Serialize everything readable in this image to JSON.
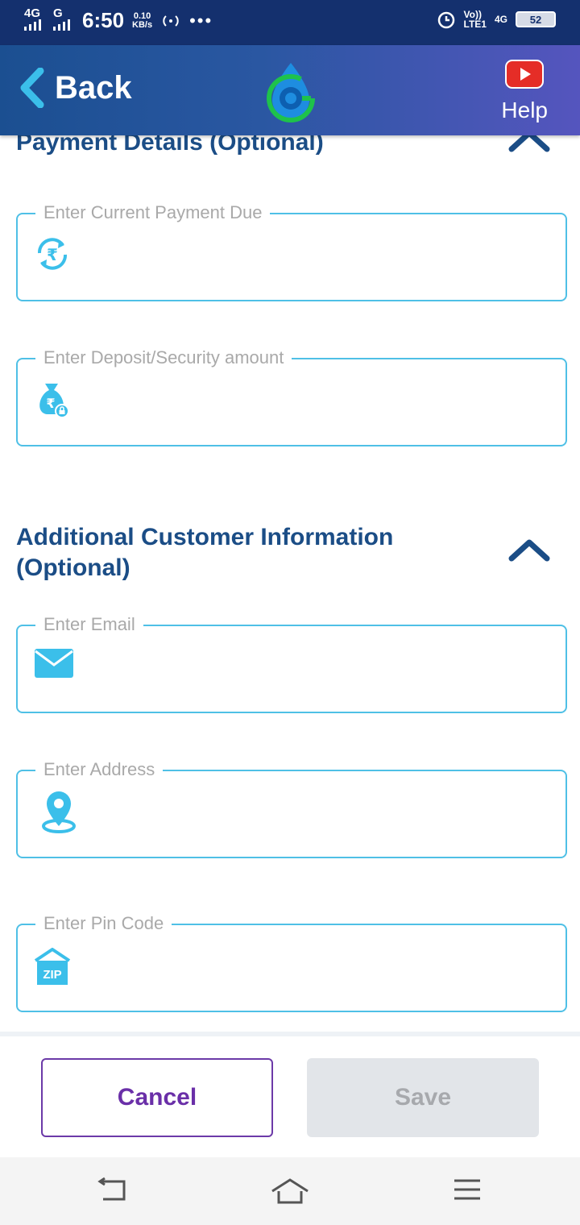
{
  "status_bar": {
    "network_1": "4G",
    "network_2": "G",
    "time": "6:50",
    "speed_value": "0.10",
    "speed_unit": "KB/s",
    "dots": "•••",
    "volte": "Vo))",
    "lte": "LTE1",
    "network_right": "4G",
    "battery": "52"
  },
  "header": {
    "back_label": "Back",
    "help_label": "Help",
    "brand_color": "#2a57a2",
    "logo_green": "#1ec24b"
  },
  "payment_section": {
    "title": "Payment Details (Optional)",
    "fields": [
      {
        "label": "Enter Current Payment Due",
        "icon": "rupee-refresh-icon",
        "value": ""
      },
      {
        "label": "Enter Deposit/Security amount",
        "icon": "money-bag-lock-icon",
        "value": ""
      }
    ]
  },
  "additional_section": {
    "title_line1": "Additional Customer Information",
    "title_line2": "(Optional)",
    "fields": [
      {
        "label": "Enter Email",
        "icon": "envelope-icon",
        "value": ""
      },
      {
        "label": "Enter Address",
        "icon": "location-pin-icon",
        "value": ""
      },
      {
        "label": "Enter Pin Code",
        "icon": "zip-house-icon",
        "icon_text": "ZIP",
        "value": ""
      }
    ]
  },
  "actions": {
    "cancel_label": "Cancel",
    "save_label": "Save",
    "accent_color": "#6a2fa8"
  },
  "colors": {
    "field_border": "#4fc0e6",
    "section_title": "#1b4d86",
    "icon": "#3bbfea"
  }
}
